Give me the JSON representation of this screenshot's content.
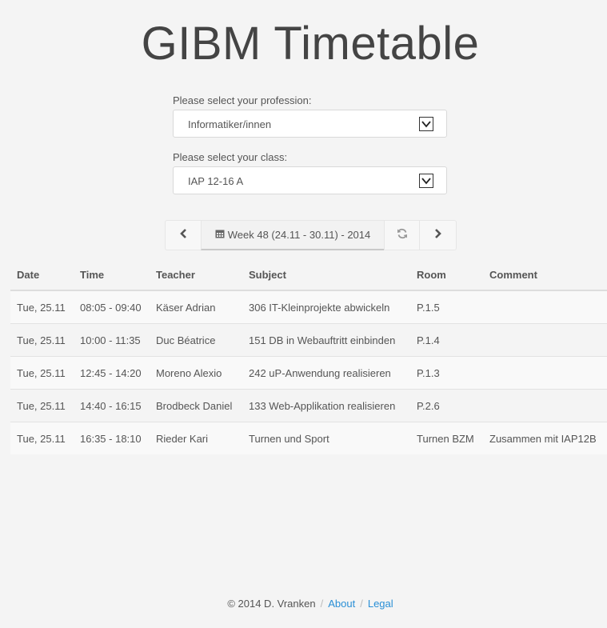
{
  "header": {
    "title": "GIBM Timetable"
  },
  "form": {
    "profession_label": "Please select your profession:",
    "profession_value": "Informatiker/innen",
    "class_label": "Please select your class:",
    "class_value": "IAP 12-16 A"
  },
  "week_nav": {
    "week_label": "Week 48 (24.11 - 30.11) - 2014",
    "prev_icon": "chevron-left-icon",
    "next_icon": "chevron-right-icon",
    "refresh_icon": "refresh-icon",
    "calendar_icon": "calendar-icon"
  },
  "table": {
    "headers": [
      "Date",
      "Time",
      "Teacher",
      "Subject",
      "Room",
      "Comment"
    ],
    "rows": [
      [
        "Tue, 25.11",
        "08:05 - 09:40",
        "Käser Adrian",
        "306 IT-Kleinprojekte abwickeln",
        "P.1.5",
        ""
      ],
      [
        "Tue, 25.11",
        "10:00 - 11:35",
        "Duc Béatrice",
        "151 DB in Webauftritt einbinden",
        "P.1.4",
        ""
      ],
      [
        "Tue, 25.11",
        "12:45 - 14:20",
        "Moreno Alexio",
        "242 uP-Anwendung realisieren",
        "P.1.3",
        ""
      ],
      [
        "Tue, 25.11",
        "14:40 - 16:15",
        "Brodbeck Daniel",
        "133 Web-Applikation realisieren",
        "P.2.6",
        ""
      ],
      [
        "Tue, 25.11",
        "16:35 - 18:10",
        "Rieder Kari",
        "Turnen und Sport",
        "Turnen BZM",
        "Zusammen mit IAP12B"
      ]
    ]
  },
  "footer": {
    "copyright": "© 2014 D. Vranken",
    "separator": "/",
    "about_label": "About",
    "legal_label": "Legal",
    "link_color": "#2a8fd6"
  }
}
